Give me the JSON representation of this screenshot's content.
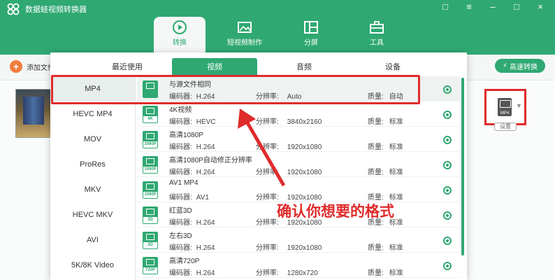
{
  "app": {
    "title": "数据蛙视频转换器"
  },
  "nav": {
    "tabs": [
      {
        "label": "转换",
        "icon": "refresh-icon",
        "active": true
      },
      {
        "label": "短视频制作",
        "icon": "image-icon",
        "active": false
      },
      {
        "label": "分屏",
        "icon": "split-screen-icon",
        "active": false
      },
      {
        "label": "工具",
        "icon": "toolbox-icon",
        "active": false
      }
    ]
  },
  "toolbar": {
    "add_file": "添加文件",
    "fast_convert": "高速转换"
  },
  "output": {
    "format_tag": "MP4",
    "settings_label": "设置"
  },
  "panel": {
    "tabs": [
      "最近使用",
      "视频",
      "音频",
      "设备"
    ],
    "formats": [
      "MP4",
      "HEVC MP4",
      "MOV",
      "ProRes",
      "MKV",
      "HEVC MKV",
      "AVI",
      "5K/8K Video"
    ],
    "labels": {
      "codec": "编码器:",
      "resolution": "分辨率:",
      "quality": "质量:"
    },
    "presets": [
      {
        "name": "与源文件相同",
        "tag": "",
        "codec": "H.264",
        "resolution": "Auto",
        "quality": "自动"
      },
      {
        "name": "4K视频",
        "tag": "4K",
        "codec": "HEVC",
        "resolution": "3840x2160",
        "quality": "标准"
      },
      {
        "name": "高清1080P",
        "tag": "1080P",
        "codec": "H.264",
        "resolution": "1920x1080",
        "quality": "标准"
      },
      {
        "name": "高清1080P自动修正分辨率",
        "tag": "1080P",
        "codec": "H.264",
        "resolution": "1920x1080",
        "quality": "标准"
      },
      {
        "name": "AV1 MP4",
        "tag": "1080P",
        "codec": "AV1",
        "resolution": "1920x1080",
        "quality": "标准"
      },
      {
        "name": "红蓝3D",
        "tag": "3D",
        "codec": "H.264",
        "resolution": "1920x1080",
        "quality": "标准"
      },
      {
        "name": "左右3D",
        "tag": "3D",
        "codec": "H.264",
        "resolution": "1920x1080",
        "quality": "标准"
      },
      {
        "name": "高清720P",
        "tag": "720P",
        "codec": "H.264",
        "resolution": "1280x720",
        "quality": "标准"
      }
    ]
  },
  "annotation": {
    "text": "确认你想要的格式",
    "color": "#e02b2b"
  },
  "colors": {
    "brand": "#2fa872",
    "accent": "#f07c3c"
  }
}
